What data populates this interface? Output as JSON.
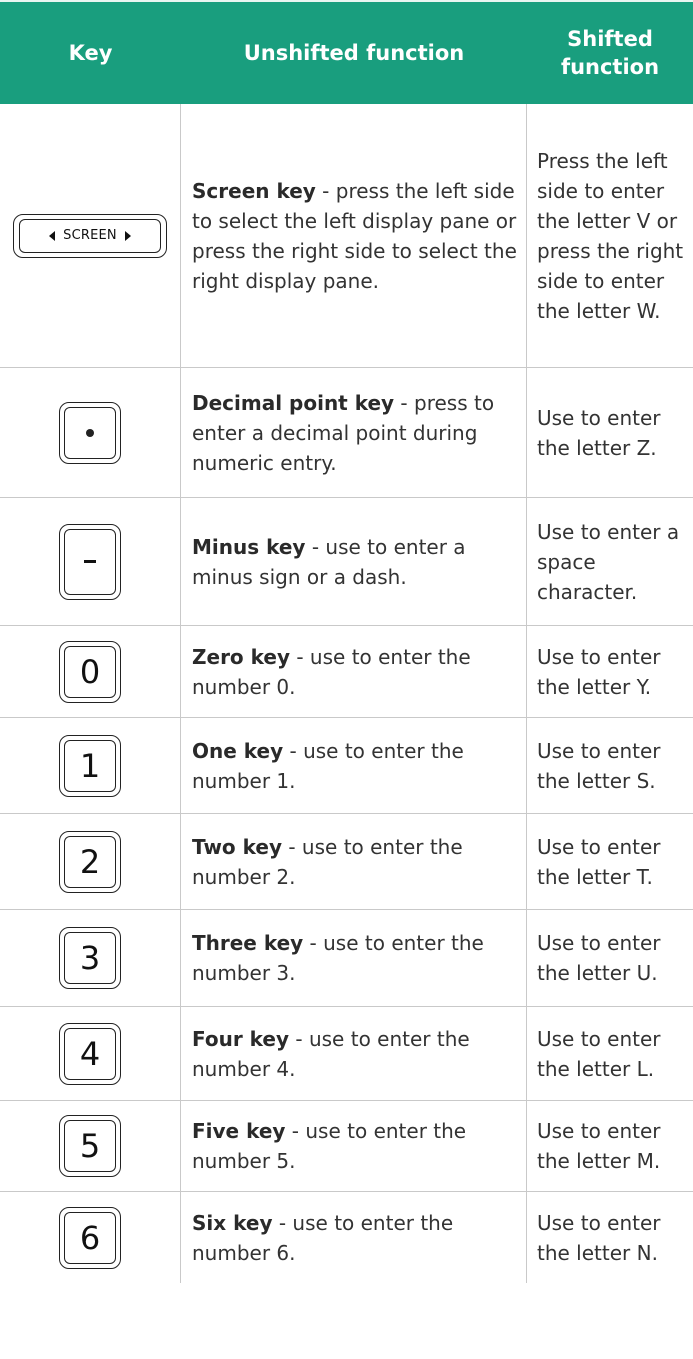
{
  "header": {
    "key": "Key",
    "unshifted": "Unshifted function",
    "shifted": "Shifted function"
  },
  "colors": {
    "header_bg": "#199e7e",
    "header_text": "#ffffff",
    "border": "#c9c9c9"
  },
  "rows": [
    {
      "key_label": "SCREEN",
      "name": "Screen key",
      "desc": " - press the left side to select the left display pane or press the right side to select the right display pane.",
      "shifted": "Press the left side to enter the letter V or press the right side to enter the letter W."
    },
    {
      "key_label": "",
      "name": "Decimal point key",
      "desc": " - press to enter a decimal point during numeric entry.",
      "shifted": "Use to enter the letter Z."
    },
    {
      "key_label": "",
      "name": "Minus key",
      "desc": " - use to enter a minus sign or a dash.",
      "shifted": "Use to enter a space character."
    },
    {
      "key_label": "0",
      "name": "Zero key",
      "desc": " - use to enter the number 0.",
      "shifted": "Use to enter the letter Y."
    },
    {
      "key_label": "1",
      "name": "One key",
      "desc": " - use to enter the number 1.",
      "shifted": "Use to enter the letter S."
    },
    {
      "key_label": "2",
      "name": "Two key",
      "desc": " - use to enter the number 2.",
      "shifted": "Use to enter the letter T."
    },
    {
      "key_label": "3",
      "name": "Three key",
      "desc": " - use to enter the number 3.",
      "shifted": "Use to enter the letter U."
    },
    {
      "key_label": "4",
      "name": "Four key",
      "desc": " - use to enter the number 4.",
      "shifted": "Use to enter the letter L."
    },
    {
      "key_label": "5",
      "name": "Five key",
      "desc": " - use to enter the number 5.",
      "shifted": "Use to enter the letter M."
    },
    {
      "key_label": "6",
      "name": "Six key",
      "desc": " - use to enter the number 6.",
      "shifted": "Use to enter the letter N."
    }
  ]
}
